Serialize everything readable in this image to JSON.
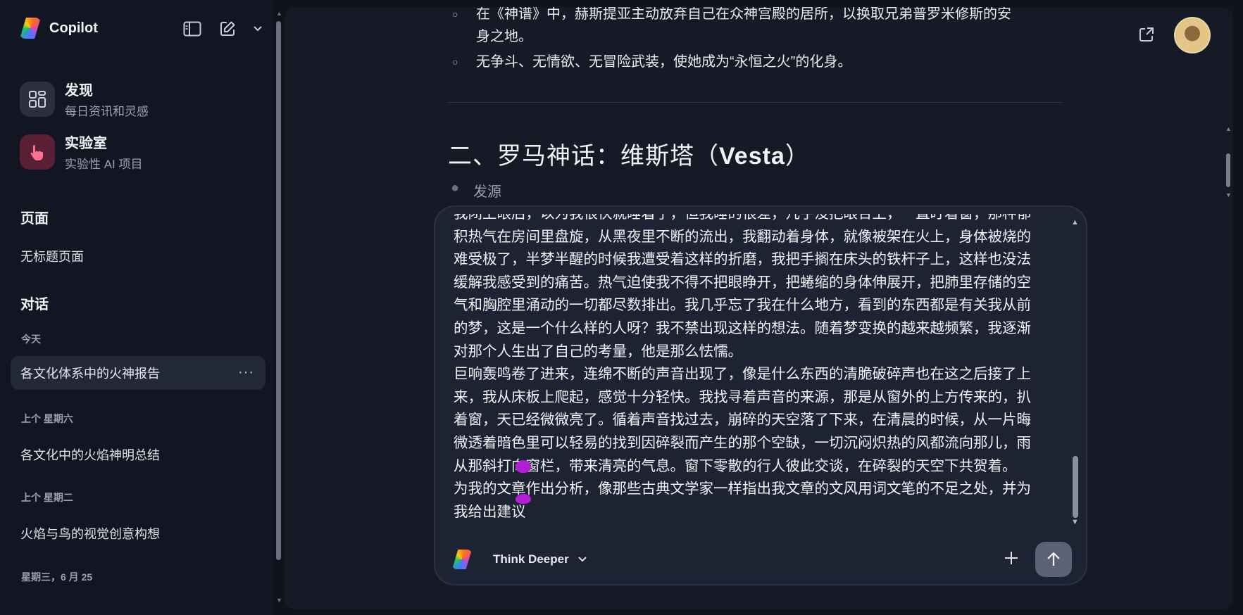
{
  "app": {
    "title": "Copilot"
  },
  "sidebar": {
    "discover": {
      "title": "发现",
      "subtitle": "每日资讯和灵感"
    },
    "labs": {
      "title": "实验室",
      "subtitle": "实验性 AI 项目"
    },
    "pages_heading": "页面",
    "pages": [
      "无标题页面"
    ],
    "conversations_heading": "对话",
    "groups": [
      {
        "label": "今天",
        "items": [
          "各文化体系中的火神报告"
        ]
      },
      {
        "label": "上个 星期六",
        "items": [
          "各文化中的火焰神明总结"
        ]
      },
      {
        "label": "上个 星期二",
        "items": [
          "火焰与鸟的视觉创意构想"
        ]
      },
      {
        "label": "星期三，6 月 25",
        "items": []
      }
    ],
    "more_label": "···"
  },
  "article": {
    "bullets_top": [
      "在《神谱》中，赫斯提亚主动放弃自己在众神宫殿的居所，以换取兄弟普罗米修斯的安",
      "身之地。",
      "无争斗、无情欲、无冒险武装，使她成为“永恒之火”的化身。"
    ],
    "heading_prefix": "二、罗马神话：维斯塔（",
    "heading_name": "Vesta",
    "heading_suffix": "）",
    "sub_bullet": "发源"
  },
  "composer": {
    "lines": [
      "我闭上眼后，以为我很快就睡着了，但我睡的很差，几乎没把眼合上，一直盯着窗，那种郁",
      "积热气在房间里盘旋，从黑夜里不断的流出，我翻动着身体，就像被架在火上，身体被烧的",
      "难受极了，半梦半醒的时候我遭受着这样的折磨，我把手搁在床头的铁杆子上，这样也没法",
      "缓解我感受到的痛苦。热气迫使我不得不把眼睁开，把蜷缩的身体伸展开，把肺里存储的空",
      "气和胸腔里涌动的一切都尽数排出。我几乎忘了我在什么地方，看到的东西都是有关我从前",
      "的梦，这是一个什么样的人呀？我不禁出现这样的想法。随着梦变换的越来越频繁，我逐渐",
      "对那个人生出了自己的考量，他是那么怯懦。",
      "巨响轰鸣卷了进来，连绵不断的声音出现了，像是什么东西的清脆破碎声也在这之后接了上",
      "来，我从床板上爬起，感觉十分轻快。我找寻着声音的来源，那是从窗外的上方传来的，扒",
      "着窗，天已经微微亮了。循着声音找过去，崩碎的天空落了下来，在清晨的时候，从一片晦",
      "微透着暗色里可以轻易的找到因碎裂而产生的那个空缺，一切沉闷炽热的风都流向那儿，雨",
      "从那斜打向窗栏，带来清亮的气息。窗下零散的行人彼此交谈，在碎裂的天空下共贺着。",
      "为我的文章作出分析，像那些古典文学家一样指出我文章的文风用词文笔的不足之处，并为",
      "我给出建议"
    ],
    "mode_label": "Think Deeper"
  },
  "colors": {
    "accent_cursor": "#b21ed6",
    "labs_badge": "#5a1e35"
  }
}
